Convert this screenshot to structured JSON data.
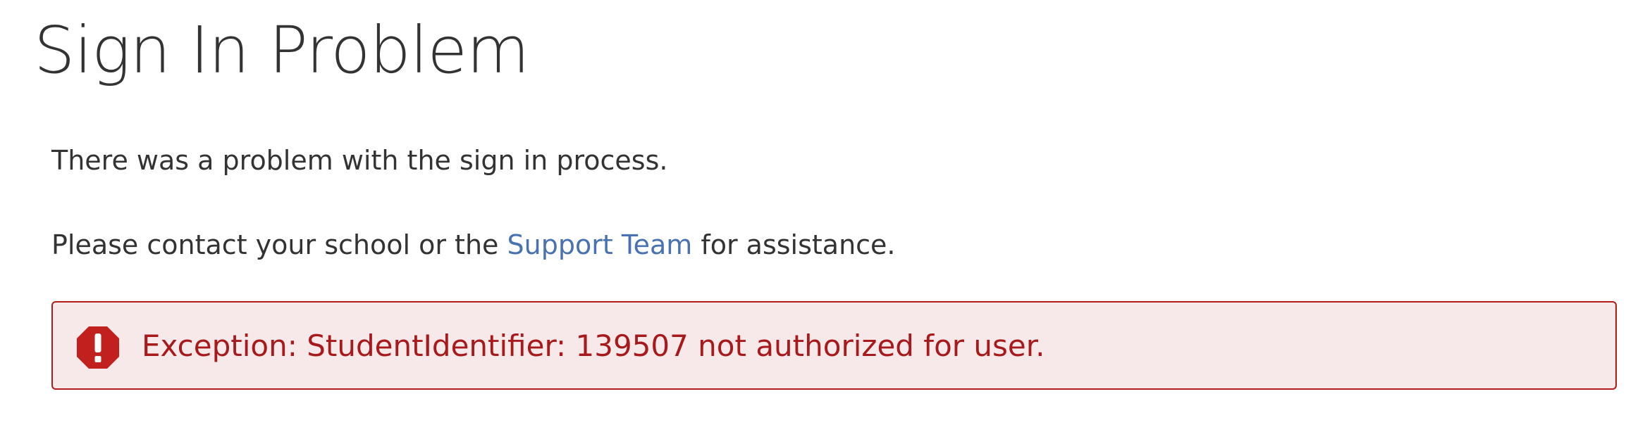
{
  "page": {
    "title": "Sign In Problem"
  },
  "message": {
    "line1": "There was a problem with the sign in process.",
    "line2_prefix": "Please contact your school or the ",
    "support_link": "Support Team",
    "line2_suffix": " for assistance."
  },
  "alert": {
    "icon": "exclamation-octagon-icon",
    "text": "Exception: StudentIdentifier: 139507 not authorized for user."
  },
  "colors": {
    "text": "#333333",
    "link": "#4a72b0",
    "alert_text": "#a8191c",
    "alert_border": "#b41a1a",
    "alert_background": "#f7e9ea",
    "alert_icon": "#c21f1f"
  }
}
